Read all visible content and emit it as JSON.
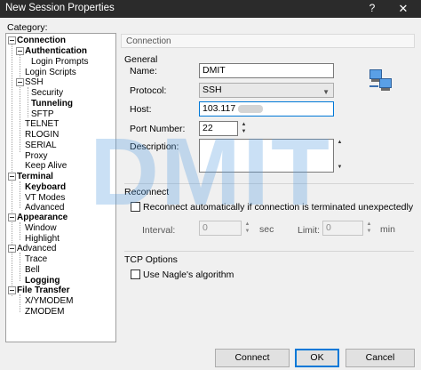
{
  "window": {
    "title": "New Session Properties",
    "help_glyph": "?",
    "close_glyph": "✕"
  },
  "category_label": "Category:",
  "tree": {
    "connection": "Connection",
    "authentication": "Authentication",
    "login_prompts": "Login Prompts",
    "login_scripts": "Login Scripts",
    "ssh": "SSH",
    "security": "Security",
    "tunneling": "Tunneling",
    "sftp": "SFTP",
    "telnet": "TELNET",
    "rlogin": "RLOGIN",
    "serial": "SERIAL",
    "proxy": "Proxy",
    "keep_alive": "Keep Alive",
    "terminal": "Terminal",
    "keyboard": "Keyboard",
    "vt_modes": "VT Modes",
    "advanced_terminal": "Advanced",
    "appearance": "Appearance",
    "window": "Window",
    "highlight": "Highlight",
    "advanced": "Advanced",
    "trace": "Trace",
    "bell": "Bell",
    "logging": "Logging",
    "file_transfer": "File Transfer",
    "xymodem": "X/YMODEM",
    "zmodem": "ZMODEM"
  },
  "panel": {
    "header": "Connection",
    "general_label": "General",
    "name_label": "Name:",
    "name_value": "DMIT",
    "protocol_label": "Protocol:",
    "protocol_value": "SSH",
    "host_label": "Host:",
    "host_value": "103.117",
    "port_label": "Port Number:",
    "port_value": "22",
    "description_label": "Description:",
    "description_value": "",
    "reconnect_label": "Reconnect",
    "reconnect_checkbox": "Reconnect automatically if connection is terminated unexpectedly",
    "interval_label": "Interval:",
    "interval_value": "0",
    "sec_label": "sec",
    "limit_label": "Limit:",
    "limit_value": "0",
    "min_label": "min",
    "tcp_label": "TCP Options",
    "nagle_checkbox": "Use Nagle's algorithm"
  },
  "watermark": "DMIT",
  "buttons": {
    "connect": "Connect",
    "ok": "OK",
    "cancel": "Cancel"
  },
  "icons": {
    "network": "network-computers-icon"
  },
  "colors": {
    "accent": "#0078d7",
    "titlebar": "#2b2b2b",
    "watermark": "#5aa0e1"
  }
}
